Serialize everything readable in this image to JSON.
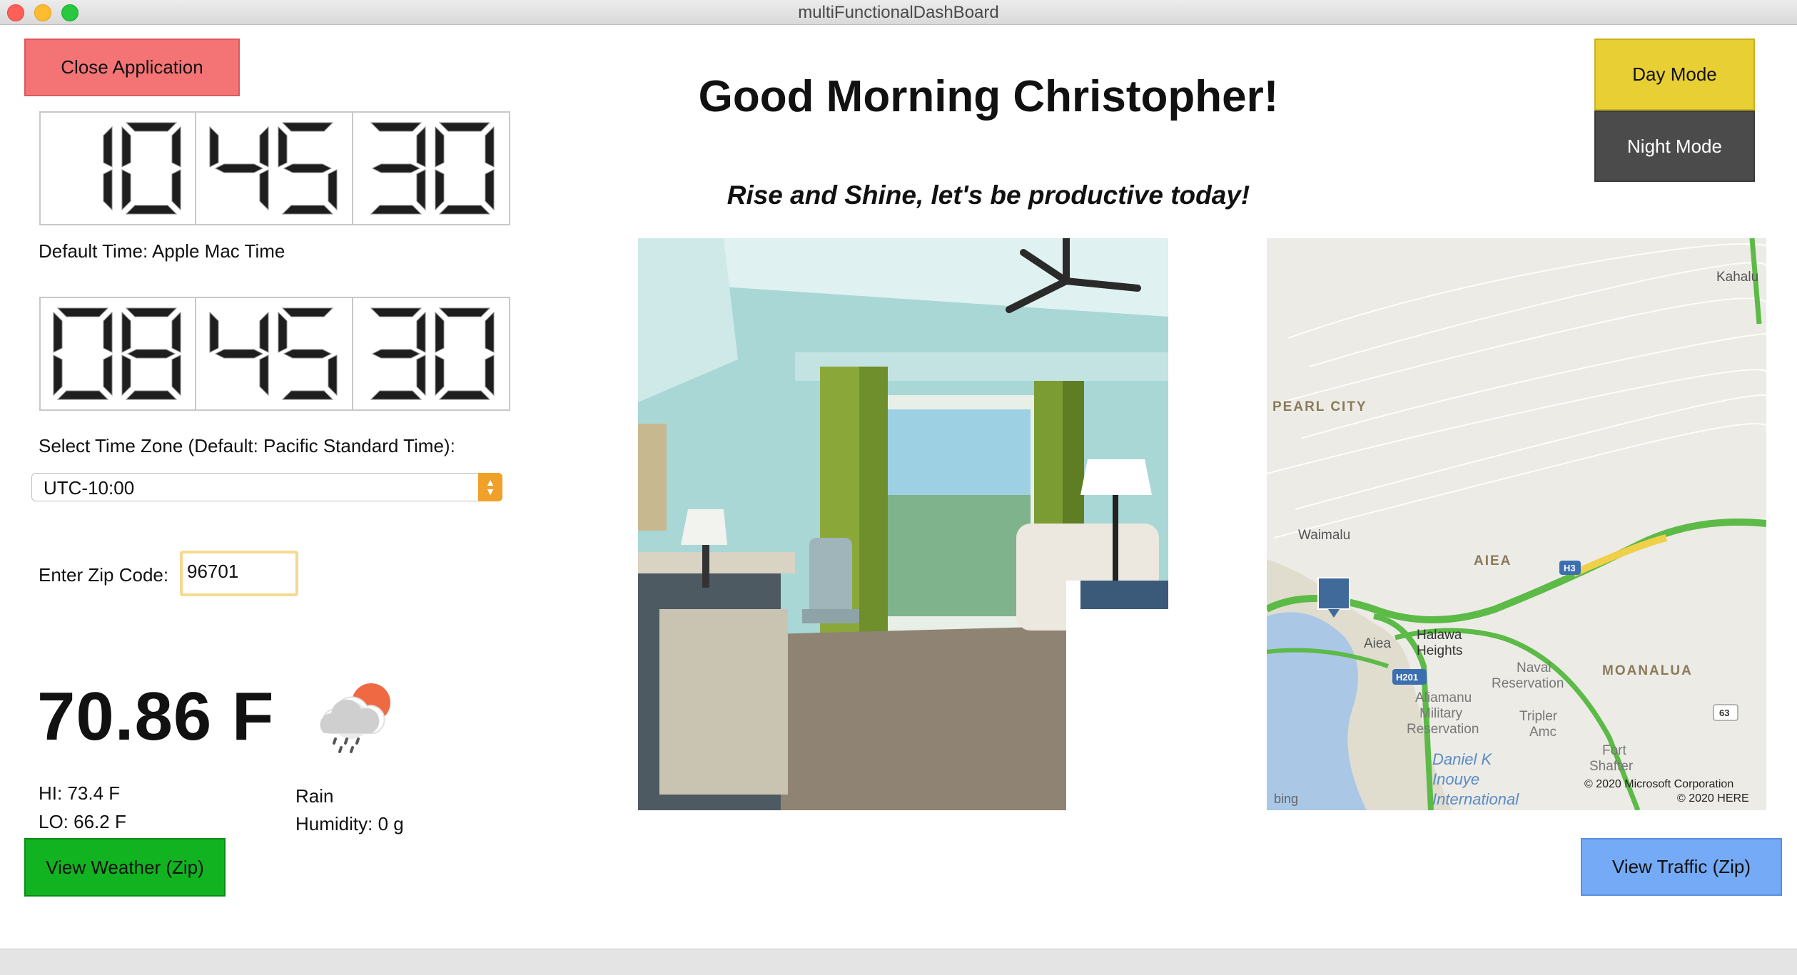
{
  "window": {
    "title": "multiFunctionalDashBoard"
  },
  "header": {
    "greeting": "Good Morning Christopher!",
    "subtitle": "Rise and Shine, let's be productive today!"
  },
  "buttons": {
    "close": "Close Application",
    "day_mode": "Day Mode",
    "night_mode": "Night Mode",
    "view_weather": "View Weather (Zip)",
    "view_traffic": "View Traffic (Zip)"
  },
  "clock_default": {
    "hours": "10",
    "minutes": "45",
    "seconds": "30",
    "label": "Default Time: Apple Mac Time"
  },
  "clock_zone": {
    "hours": "08",
    "minutes": "45",
    "seconds": "30"
  },
  "timezone": {
    "label": "Select Time Zone (Default: Pacific Standard Time):",
    "selected": "UTC-10:00"
  },
  "zip": {
    "label": "Enter Zip Code:",
    "value": "96701"
  },
  "weather": {
    "temperature": "70.86 F",
    "hi": "HI: 73.4 F",
    "lo": "LO: 66.2 F",
    "condition": "Rain",
    "humidity": "Humidity: 0 g",
    "icon": "cloud-rain-sun-icon"
  },
  "map": {
    "labels": {
      "kahalu": "Kahalu",
      "pearl_city": "PEARL CITY",
      "waimalu": "Waimalu",
      "aiea_area": "AIEA",
      "aiea": "Aiea",
      "halawa": "Halawa",
      "heights": "Heights",
      "naval": "Naval",
      "reservation": "Reservation",
      "moanalua": "MOANALUA",
      "aliamanu": "Aliamanu",
      "military": "Military",
      "reservation2": "Reservation",
      "tripler": "Tripler",
      "amc": "Amc",
      "fort": "Fort",
      "shafter": "Shafter",
      "daniel": "Daniel K",
      "inouye": "Inouye",
      "international": "International",
      "bing": "bing",
      "copyright1": "© 2020 Microsoft Corporation",
      "copyright2": "© 2020 HERE",
      "h3": "H3",
      "h201": "H201",
      "r63": "63"
    }
  }
}
